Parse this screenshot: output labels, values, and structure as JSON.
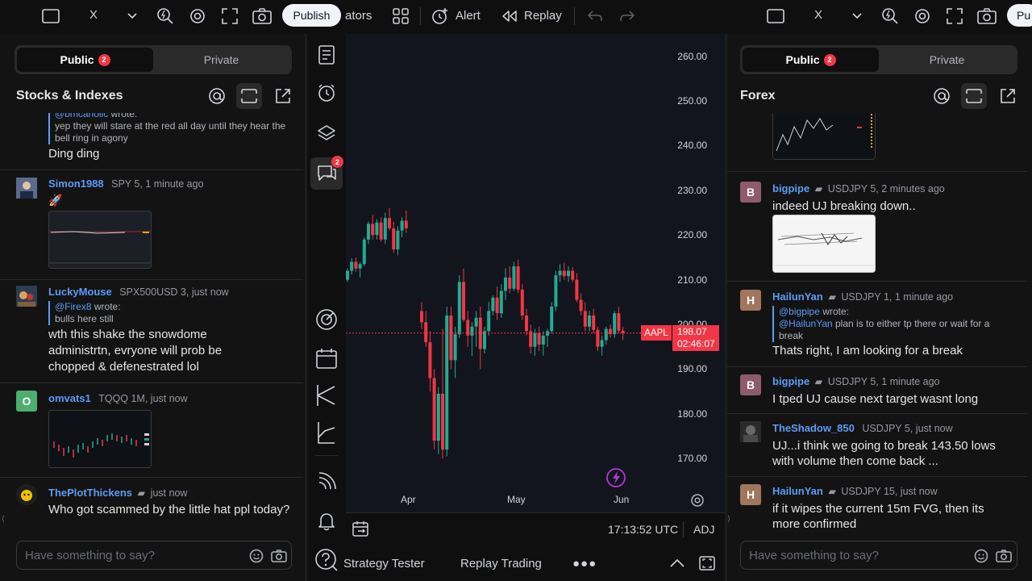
{
  "left_toolbar": {
    "x_label": "X",
    "publish": "Publish",
    "indicators": "ators",
    "alert": "Alert",
    "replay": "Replay"
  },
  "right_toolbar": {
    "x_label": "X",
    "publish": "Pu"
  },
  "left_panel": {
    "tab_public": "Public",
    "tab_public_badge": "2",
    "tab_private": "Private",
    "room": "Stocks & Indexes",
    "input_placeholder": "Have something to say?",
    "messages": [
      {
        "quote_name": "@bmcaholic",
        "quote_suffix": " wrote:",
        "quote_text": "yep they will stare at the red all day until they hear the bell ring in agony",
        "text": "Ding ding"
      },
      {
        "user": "Simon1988",
        "meta": "SPY 5, 1 minute ago",
        "text": "🚀"
      },
      {
        "user": "LuckyMouse",
        "meta": "SPX500USD 3, just now",
        "quote_name": "@Firex8",
        "quote_suffix": " wrote:",
        "quote_text": "bulls here still",
        "text": "wth this shake the snowdome administrtn, evryone will prob be chopped & defenestrated lol"
      },
      {
        "user": "omvats1",
        "avatar": "O",
        "meta": "TQQQ 1M, just now"
      },
      {
        "user": "ThePlotThickens",
        "meta": "just now",
        "text": "Who got scammed by the little hat ppl today?"
      }
    ]
  },
  "chart": {
    "symbol": "AAPL",
    "last_price": "198.07",
    "countdown": "02:46:07",
    "price_axis": [
      "260.00",
      "250.00",
      "240.00",
      "230.00",
      "220.00",
      "210.00",
      "200.00",
      "190.00",
      "180.00",
      "170.00"
    ],
    "time_axis": [
      "Apr",
      "May",
      "Jun"
    ],
    "time": "17:13:52 UTC",
    "adj": "ADJ",
    "bottom_tabs": [
      "Strategy Tester",
      "Replay Trading"
    ],
    "chat_badge": "2",
    "colors": {
      "up": "#22ab94",
      "down": "#f23645",
      "accent": "#2962ff"
    }
  },
  "chart_data": {
    "type": "candlestick",
    "symbol": "AAPL",
    "ylim": [
      163,
      265
    ],
    "x_ticks": [
      "Apr",
      "May",
      "Jun"
    ],
    "last": 198.07,
    "candles": [
      [
        210.0,
        212.5,
        209.5,
        212.0
      ],
      [
        212.0,
        214.8,
        211.2,
        214.0
      ],
      [
        214.0,
        215.0,
        211.8,
        212.5
      ],
      [
        212.5,
        214.0,
        210.5,
        213.5
      ],
      [
        213.5,
        219.5,
        213.0,
        219.0
      ],
      [
        219.0,
        223.0,
        218.0,
        222.5
      ],
      [
        222.5,
        224.5,
        219.0,
        220.0
      ],
      [
        220.0,
        223.5,
        219.0,
        222.8
      ],
      [
        222.8,
        224.0,
        218.5,
        219.0
      ],
      [
        219.0,
        225.0,
        218.0,
        223.8
      ],
      [
        223.8,
        226.0,
        221.0,
        221.5
      ],
      [
        221.5,
        223.0,
        216.0,
        216.8
      ],
      [
        216.8,
        222.0,
        215.5,
        221.0
      ],
      [
        221.0,
        224.0,
        219.5,
        223.2
      ],
      [
        223.2,
        225.5,
        220.5,
        221.5
      ],
      [
        203.0,
        205.0,
        199.0,
        200.5
      ],
      [
        200.5,
        203.0,
        195.0,
        196.0
      ],
      [
        196.0,
        198.5,
        185.0,
        188.0
      ],
      [
        188.0,
        190.0,
        172.0,
        174.0
      ],
      [
        174.0,
        186.0,
        171.0,
        184.5
      ],
      [
        184.5,
        199.0,
        170.0,
        172.0
      ],
      [
        172.0,
        204.0,
        170.5,
        202.0
      ],
      [
        202.0,
        204.0,
        190.0,
        192.0
      ],
      [
        192.0,
        199.5,
        188.0,
        197.8
      ],
      [
        197.8,
        211.0,
        197.0,
        209.5
      ],
      [
        209.5,
        212.5,
        200.5,
        201.0
      ],
      [
        201.0,
        203.0,
        195.0,
        197.5
      ],
      [
        197.5,
        200.5,
        193.0,
        199.5
      ],
      [
        199.5,
        203.0,
        195.0,
        201.5
      ],
      [
        201.5,
        204.0,
        190.0,
        194.5
      ],
      [
        194.5,
        199.5,
        193.5,
        198.5
      ],
      [
        198.5,
        205.0,
        197.5,
        203.0
      ],
      [
        203.0,
        206.5,
        202.0,
        206.0
      ],
      [
        206.0,
        208.5,
        201.0,
        202.5
      ],
      [
        202.5,
        209.0,
        201.5,
        207.5
      ],
      [
        207.5,
        212.5,
        205.5,
        210.5
      ],
      [
        210.5,
        213.0,
        207.0,
        208.0
      ],
      [
        208.0,
        214.0,
        207.5,
        213.0
      ],
      [
        213.0,
        214.5,
        207.0,
        207.8
      ],
      [
        207.8,
        209.0,
        201.0,
        202.0
      ],
      [
        202.0,
        203.5,
        197.5,
        198.5
      ],
      [
        198.5,
        200.0,
        193.5,
        195.0
      ],
      [
        195.0,
        199.0,
        193.0,
        198.0
      ],
      [
        198.0,
        199.5,
        194.0,
        195.5
      ],
      [
        195.5,
        198.5,
        193.0,
        197.5
      ],
      [
        197.5,
        199.0,
        195.0,
        198.5
      ],
      [
        198.5,
        205.0,
        198.0,
        204.0
      ],
      [
        204.0,
        212.0,
        203.0,
        211.0
      ],
      [
        211.0,
        213.5,
        209.5,
        212.0
      ],
      [
        212.0,
        213.8,
        210.0,
        210.8
      ],
      [
        210.8,
        213.0,
        209.5,
        212.0
      ],
      [
        212.0,
        212.8,
        209.5,
        210.0
      ],
      [
        210.0,
        211.5,
        205.0,
        205.5
      ],
      [
        205.5,
        207.0,
        202.0,
        203.0
      ],
      [
        203.0,
        205.0,
        198.5,
        199.5
      ],
      [
        199.5,
        203.0,
        198.5,
        202.0
      ],
      [
        202.0,
        203.5,
        198.0,
        198.8
      ],
      [
        198.8,
        199.5,
        194.0,
        195.0
      ],
      [
        195.0,
        197.5,
        193.0,
        196.5
      ],
      [
        196.5,
        199.5,
        195.5,
        199.0
      ],
      [
        199.0,
        200.0,
        197.0,
        197.8
      ],
      [
        197.8,
        203.0,
        197.0,
        202.5
      ],
      [
        202.5,
        204.0,
        198.0,
        198.6
      ],
      [
        198.6,
        199.5,
        196.5,
        198.07
      ]
    ]
  },
  "right_panel": {
    "tab_public": "Public",
    "tab_public_badge": "2",
    "tab_private": "Private",
    "room": "Forex",
    "input_placeholder": "Have something to say?",
    "messages": [
      {
        "user": "bigpipe",
        "avatar": "B",
        "meta": "USDJPY 5, 2 minutes ago",
        "text": "indeed UJ breaking down.."
      },
      {
        "user": "HailunYan",
        "avatar": "H",
        "meta": "USDJPY 1, 1 minute ago",
        "quote_name": "@bigpipe",
        "quote_suffix": " wrote:",
        "quote_name2": "@HailunYan",
        "quote_text": " plan is to either tp there or wait for a break",
        "text": "Thats right, I am looking for a break"
      },
      {
        "user": "bigpipe",
        "avatar": "B",
        "meta": "USDJPY 5, 1 minute ago",
        "text": "I tped UJ cause next target wasnt long"
      },
      {
        "user": "TheShadow_850",
        "meta": "USDJPY 5, just now",
        "text": "UJ...i think we going to break 143.50 lows with volume then come back ..."
      },
      {
        "user": "HailunYan",
        "avatar": "H",
        "meta": "USDJPY 15, just now",
        "text": "if it wipes the current 15m FVG, then its more confirmed"
      }
    ]
  }
}
